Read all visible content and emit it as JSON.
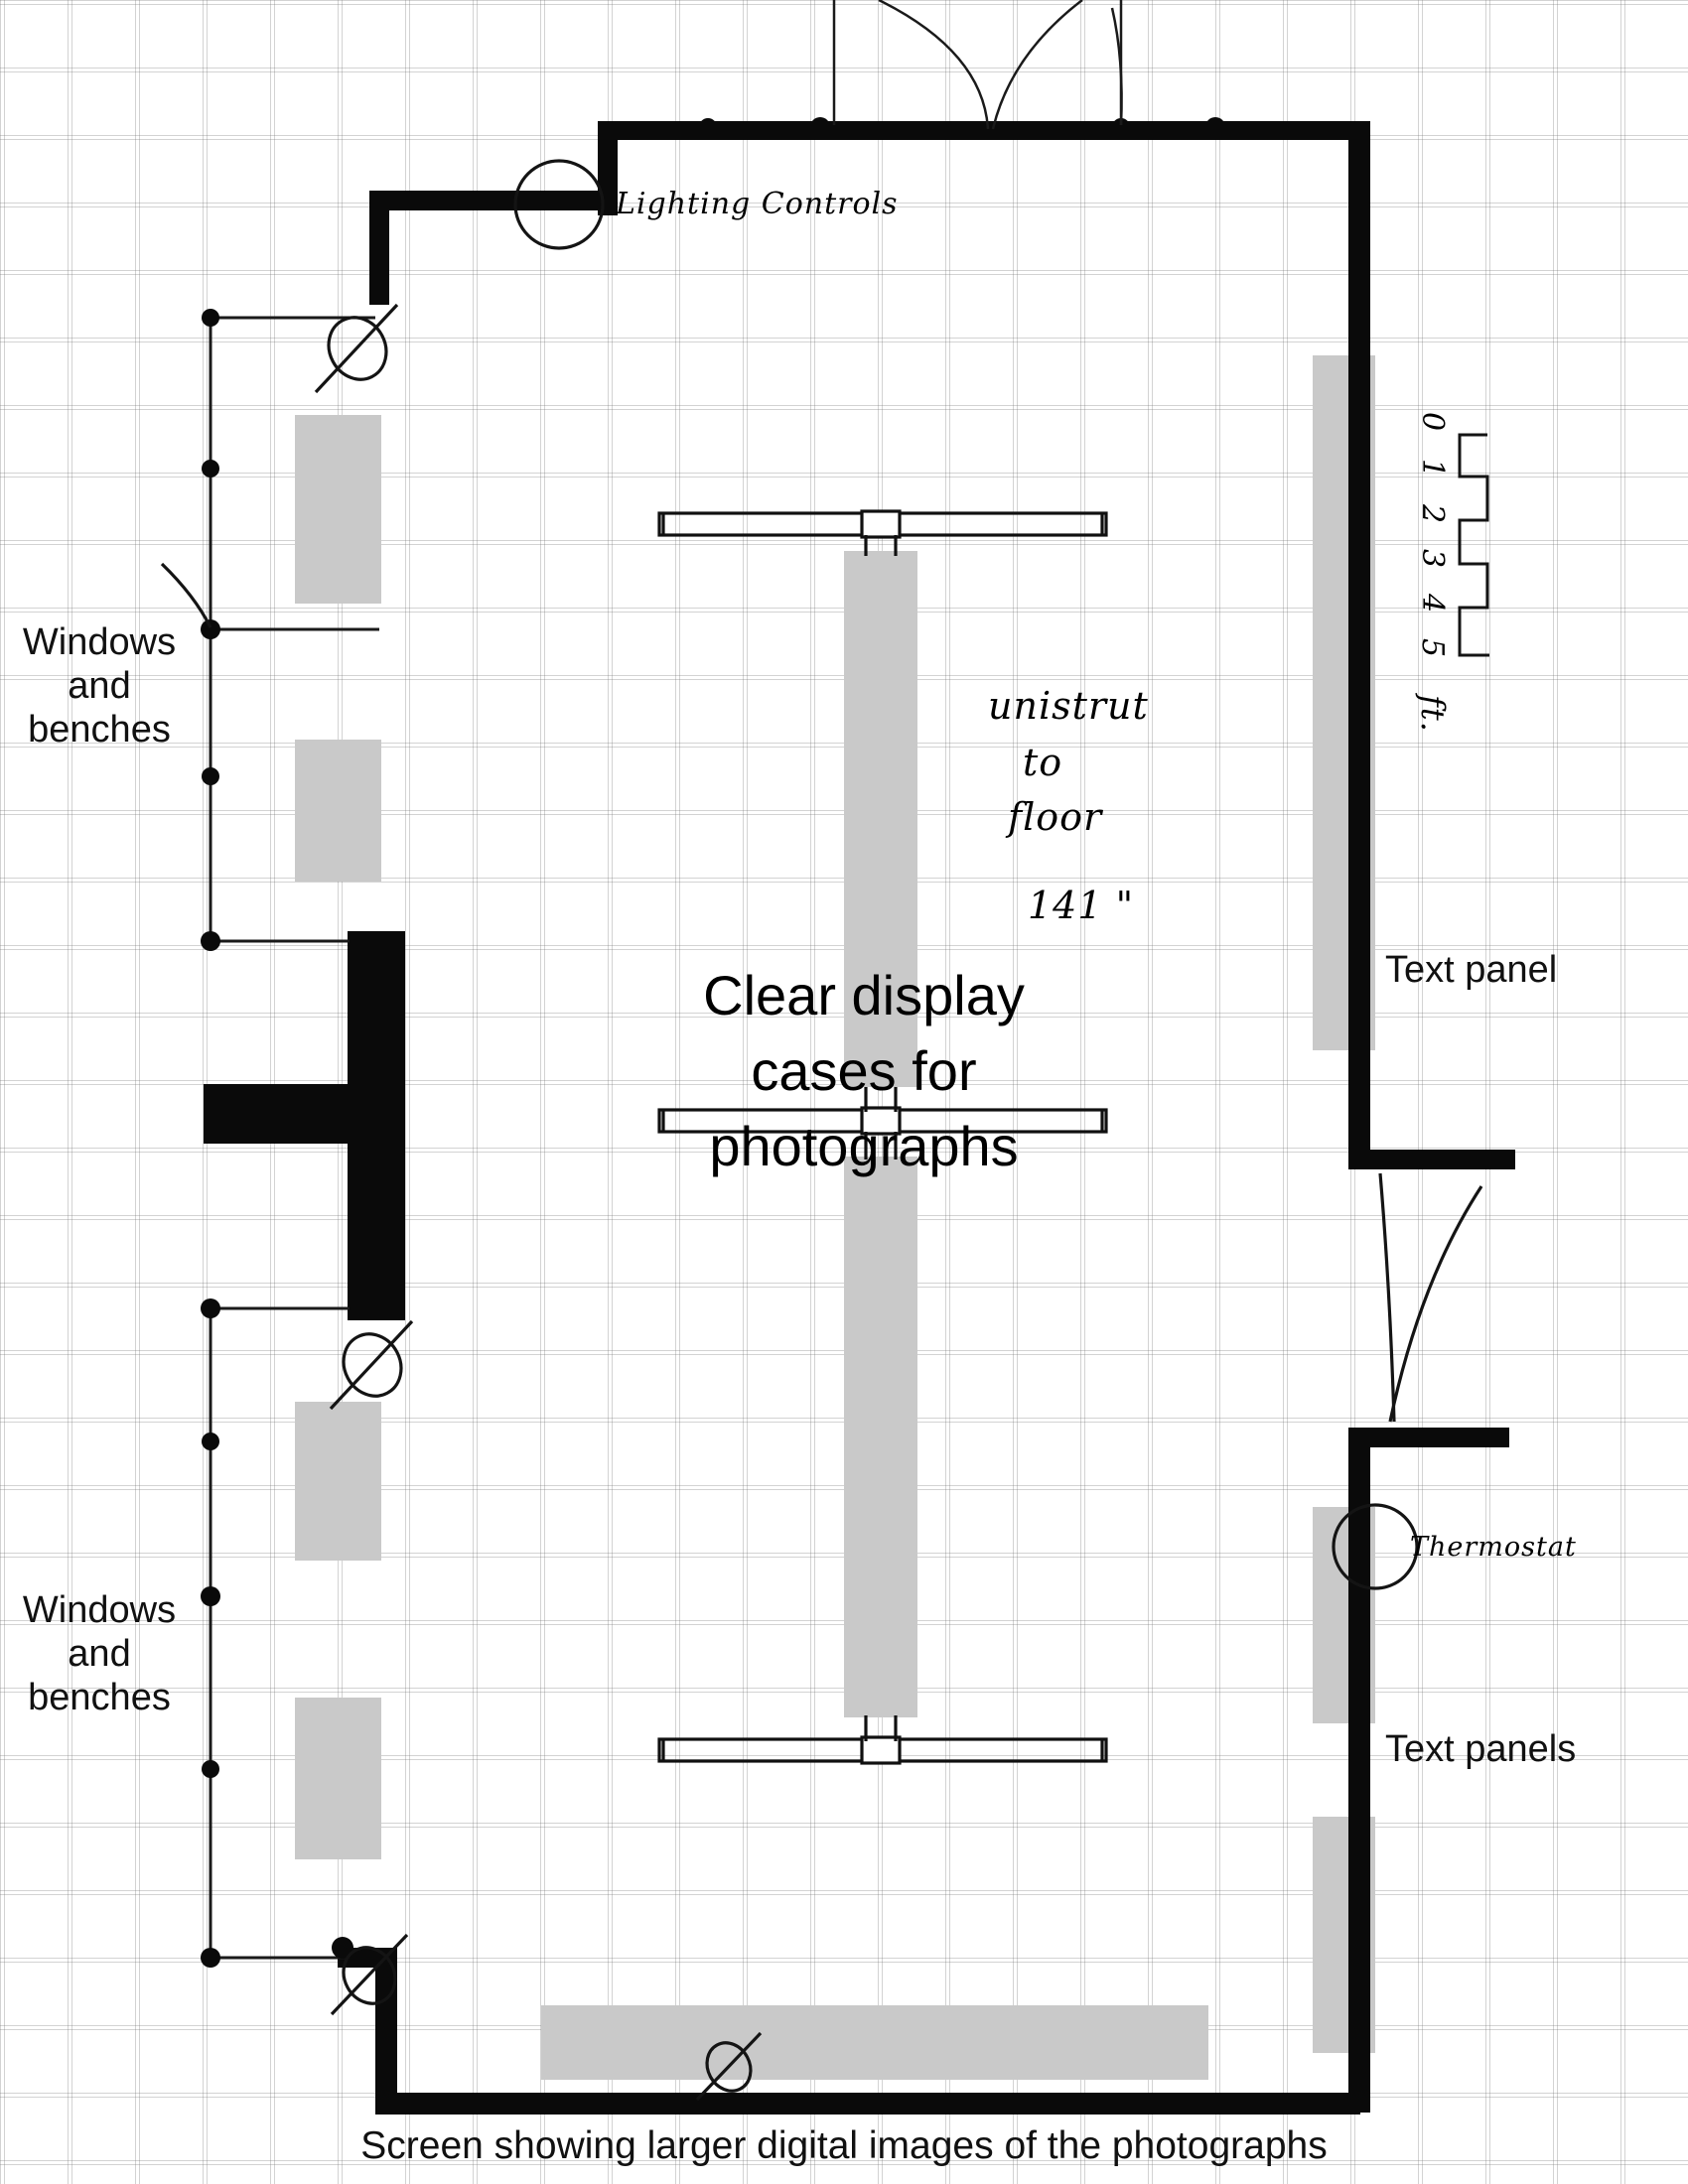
{
  "drawing": {
    "kind": "exhibition-gallery-floor-plan-sketch",
    "paper": "graph paper"
  },
  "labels": {
    "windows_benches_upper": "Windows\nand\nbenches",
    "windows_benches_lower": "Windows\nand\nbenches",
    "center_display": "Clear display\ncases for\nphotographs",
    "text_panel_single": "Text panel",
    "text_panels_plural": "Text panels",
    "bottom_caption": "Screen showing larger digital images of the photographs"
  },
  "annotations": {
    "lighting_controls": "Lighting Controls",
    "thermostat": "Thermostat",
    "unistrut_note_line1": "unistrut",
    "unistrut_note_line2": "to",
    "unistrut_note_line3": "floor",
    "dimension": "141 \"",
    "dimension_value": "141",
    "dimension_unit": "inches"
  },
  "scale_bar": {
    "ticks": [
      "0",
      "1",
      "2",
      "3",
      "4",
      "5"
    ],
    "unit": "ft."
  },
  "colors": {
    "ink": "#000000",
    "fill_gray": "#c9c9c9",
    "paper": "#ffffff",
    "grid": "#6e6e6e"
  },
  "icons": {
    "lighting_control_symbol": "circle-icon",
    "thermostat_symbol": "circle-icon",
    "outlet_symbol": "crossed-circle-icon",
    "door_swing": "arc-icon",
    "wall_node": "dot-icon"
  }
}
